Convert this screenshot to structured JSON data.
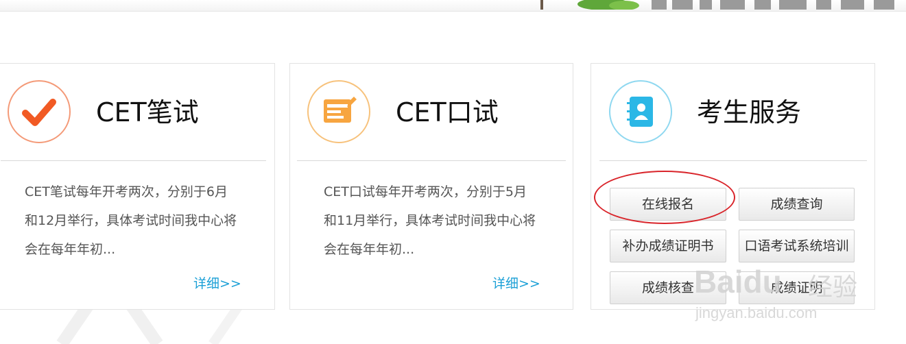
{
  "cards": [
    {
      "title": "CET笔试",
      "desc": "CET笔试每年开考两次，分别于6月和12月举行，具体考试时间我中心将会在每年年初...",
      "more": "详细>>"
    },
    {
      "title": "CET口试",
      "desc": "CET口试每年开考两次，分别于5月和11月举行，具体考试时间我中心将会在每年年初...",
      "more": "详细>>"
    }
  ],
  "services": {
    "title": "考生服务",
    "buttons": [
      "在线报名",
      "成绩查询",
      "补办成绩证明书",
      "口语考试系统培训",
      "成绩核查",
      "成绩证明"
    ]
  },
  "watermark": {
    "brand": "Baidu",
    "label": "经验",
    "url": "jingyan.baidu.com"
  },
  "colors": {
    "link": "#1a9fd6",
    "highlight": "#d9242a",
    "written_icon": "#f15a24",
    "oral_icon": "#f7a540",
    "service_icon": "#2bb7e6"
  }
}
